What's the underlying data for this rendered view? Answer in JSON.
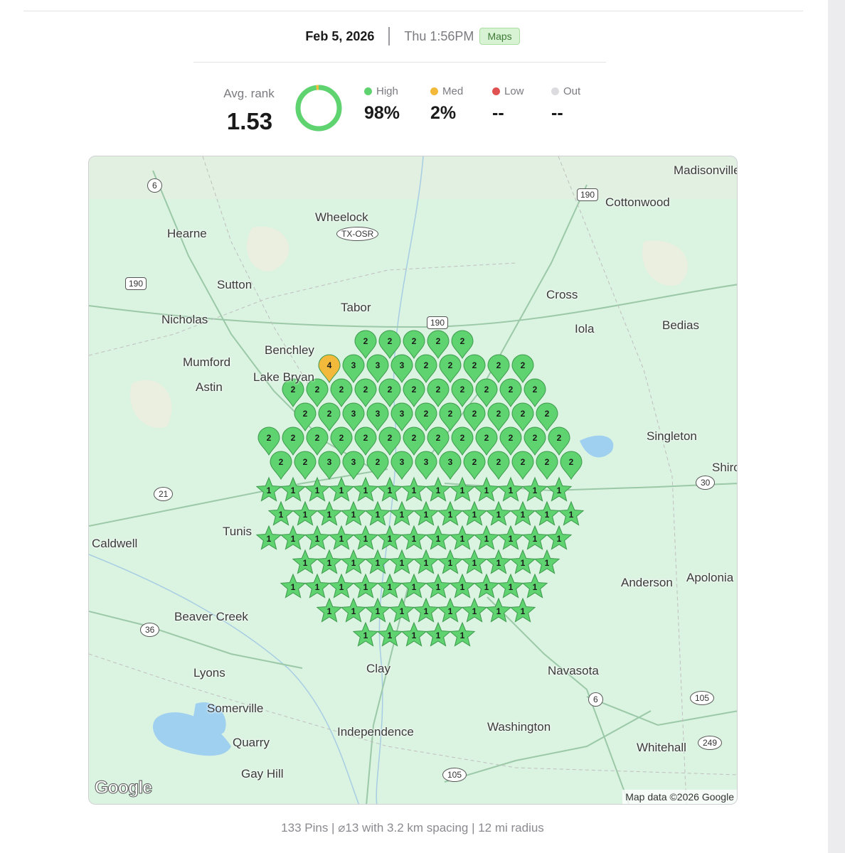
{
  "header": {
    "date": "Feb 5, 2026",
    "time": "Thu 1:56PM",
    "badge": "Maps"
  },
  "summary": {
    "avg_rank_label": "Avg. rank",
    "avg_rank_value": "1.53",
    "donut_high_fraction": 0.98,
    "legend": [
      {
        "label": "High",
        "value": "98%",
        "color": "#5fd36f"
      },
      {
        "label": "Med",
        "value": "2%",
        "color": "#f3b93a"
      },
      {
        "label": "Low",
        "value": "--",
        "color": "#e05252"
      },
      {
        "label": "Out",
        "value": "--",
        "color": "#dcdce0"
      }
    ]
  },
  "map": {
    "places": [
      "Madisonville",
      "Cottonwood",
      "Wheelock",
      "Hearne",
      "Sutton",
      "Tabor",
      "Cross",
      "Bedias",
      "Nicholas",
      "Iola",
      "Benchley",
      "Mumford",
      "Lake Bryan",
      "Astin",
      "Singleton",
      "Shiro",
      "Tunis",
      "Caldwell",
      "Anderson",
      "Apolonia",
      "Beaver Creek",
      "Lyons",
      "Clay",
      "Navasota",
      "Somerville",
      "Independence",
      "Washington",
      "Quarry",
      "Whitehall",
      "Gay Hill"
    ],
    "shields": [
      "6",
      "190",
      "TX-OSR",
      "190",
      "190",
      "21",
      "30",
      "36",
      "6",
      "105",
      "249",
      "105"
    ],
    "attribution": "Map data ©2026 Google",
    "logo_text": "Google",
    "pin_colors": {
      "high": "#5fd36f",
      "med": "#f3b93a"
    }
  },
  "footer": {
    "text": "133 Pins | ⌀13 with 3.2 km spacing | 12 mi radius"
  }
}
